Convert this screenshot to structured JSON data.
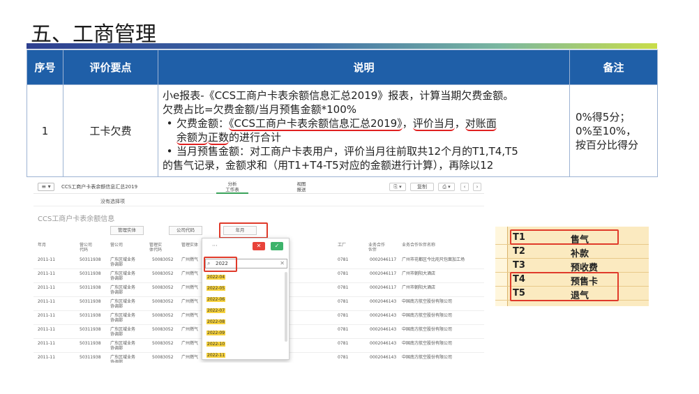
{
  "slide": {
    "title": "五、工商管理"
  },
  "table": {
    "headers": {
      "seq": "序号",
      "item": "评价要点",
      "desc": "说明",
      "note": "备注"
    },
    "row": {
      "seq": "1",
      "item": "工卡欠费",
      "desc_line1": "小e报表-《CCS工商户卡表余额信息汇总2019》报表，计算当期欠费金额。",
      "desc_line2": "欠费占比=欠费金额/当月预售金额*100%",
      "bullet1_a": "欠费金额：",
      "bullet1_b": "《CCS工商户卡表余额信息汇总2019》",
      "bullet1_c": "，",
      "bullet1_d": "评价当月",
      "bullet1_e": "，",
      "bullet1_f": "对账面",
      "bullet1_g": "余额为",
      "bullet1_h": "正数",
      "bullet1_i": "的进行合计",
      "bullet2_a": "当月预售金额：对工商户卡表用户，评价当月往前取共12个月的T1,T4,T5",
      "bullet2_b": "的售气记录，金额求和（用T1+T4-T5对应的金额进行计算），再除以12",
      "note_line1": "0%得5分；",
      "note_line2": "0%至10%，",
      "note_line3": "按百分比得分"
    }
  },
  "screenshot": {
    "menu_icon": "≡ ▾",
    "doc_title": "CCS工商户卡表余额信息汇总2019",
    "tabs": [
      {
        "label": "分析",
        "sub": "工作表"
      },
      {
        "label": "视图",
        "sub": "报送"
      }
    ],
    "buttons": {
      "bookmark": "⎘ ▾",
      "copy": "复制",
      "print": "⎙ ▾",
      "prev": "‹",
      "next": "›"
    },
    "subbar_text": "没有选择项",
    "sheet_title": "CCS工商户卡表余额信息",
    "filters": [
      "管理实体",
      "公司代码",
      "年月"
    ],
    "columns": [
      "年月",
      "营公司代码",
      "营公司",
      "管理实体代码",
      "管理实体",
      "工厂",
      "业务合作伙伴",
      "业务合作伙伴名称"
    ],
    "rows": [
      {
        "ym": "2011-11",
        "code": "50311938",
        "co": "广东区域业务协调部",
        "mcode": "50083052",
        "m": "广州燃气",
        "plant": "0781",
        "bp": "0002046117",
        "bpname": "广州市花都区今比咫尺包面加工场"
      },
      {
        "ym": "2011-11",
        "code": "50311938",
        "co": "广东区域业务协调部",
        "mcode": "50083052",
        "m": "广州燃气",
        "plant": "0781",
        "bp": "0002046117",
        "bpname": "广州市朝阳大酒店"
      },
      {
        "ym": "2011-11",
        "code": "50311938",
        "co": "广东区域业务协调部",
        "mcode": "50083052",
        "m": "广州燃气",
        "plant": "0781",
        "bp": "0002046117",
        "bpname": "广州市朝阳大酒店"
      },
      {
        "ym": "2011-11",
        "code": "50311938",
        "co": "广东区域业务协调部",
        "mcode": "50083052",
        "m": "广州燃气",
        "plant": "0781",
        "bp": "0002046143",
        "bpname": "中国南方航空股份有限公司"
      },
      {
        "ym": "2011-11",
        "code": "50311938",
        "co": "广东区域业务协调部",
        "mcode": "50083052",
        "m": "广州燃气",
        "plant": "0781",
        "bp": "0002046143",
        "bpname": "中国南方航空股份有限公司"
      },
      {
        "ym": "2011-11",
        "code": "50311938",
        "co": "广东区域业务协调部",
        "mcode": "50083052",
        "m": "广州燃气",
        "plant": "0781",
        "bp": "0002046143",
        "bpname": "中国南方航空股份有限公司"
      },
      {
        "ym": "2011-11",
        "code": "50311938",
        "co": "广东区域业务协调部",
        "mcode": "50083052",
        "m": "广州燃气",
        "plant": "0781",
        "bp": "0002046143",
        "bpname": "中国南方航空股份有限公司"
      },
      {
        "ym": "2011-11",
        "code": "50311938",
        "co": "广东区域业务协调部",
        "mcode": "50083052",
        "m": "广州燃气",
        "plant": "0781",
        "bp": "0002046143",
        "bpname": "中国南方航空股份有限公司"
      }
    ],
    "popup": {
      "dots": "···",
      "cancel": "✕",
      "confirm": "✓",
      "search_value": "2022",
      "clear": "✕",
      "items": [
        "2022-04",
        "2022-05",
        "2022-06",
        "2022-07",
        "2022-08",
        "2022-09",
        "2022-10",
        "2022-11"
      ]
    }
  },
  "legend": {
    "rows": [
      {
        "code": "T1",
        "name": "售气"
      },
      {
        "code": "T2",
        "name": "补款"
      },
      {
        "code": "T3",
        "name": "预收费"
      },
      {
        "code": "T4",
        "name": "预售卡"
      },
      {
        "code": "T5",
        "name": "退气"
      }
    ]
  },
  "colors": {
    "header_blue": "#1f5fa8",
    "annotation_red": "#e03a2a",
    "highlight_yellow": "#f7d23c"
  }
}
